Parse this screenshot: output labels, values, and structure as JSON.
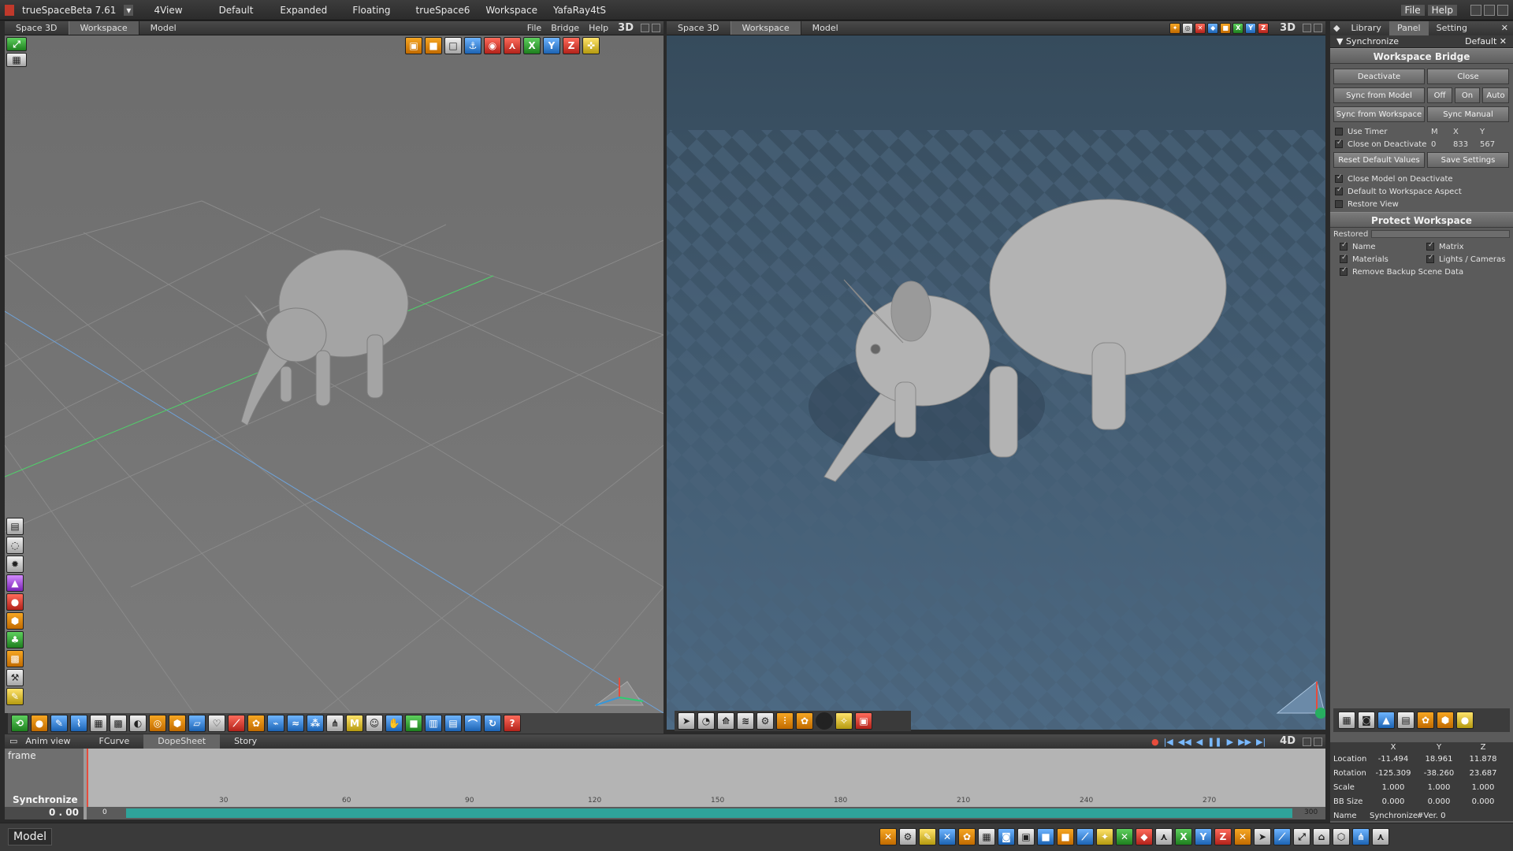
{
  "titlebar": {
    "app_title": "trueSpaceBeta 7.61",
    "menu_items": [
      "4View",
      "Default",
      "Expanded",
      "Floating",
      "trueSpace6",
      "Workspace",
      "YafaRay4tS"
    ],
    "file": "File",
    "help": "Help"
  },
  "left_pane": {
    "tabs": [
      "Space 3D",
      "Workspace",
      "Model"
    ],
    "menu": [
      "File",
      "Bridge",
      "Help"
    ],
    "mode": "3D"
  },
  "right_pane": {
    "tabs": [
      "Space 3D",
      "Workspace",
      "Model"
    ],
    "mode": "3D"
  },
  "right_panel": {
    "tabs": [
      "Library",
      "Panel",
      "Setting"
    ],
    "section": "Synchronize",
    "preset": "Default",
    "title": "Workspace Bridge",
    "buttons": {
      "deactivate": "Deactivate",
      "close": "Close",
      "sync_from_model": "Sync from Model",
      "off": "Off",
      "on": "On",
      "auto": "Auto",
      "sync_from_workspace": "Sync from Workspace",
      "sync_manual": "Sync Manual",
      "reset_default": "Reset Default Values",
      "save_settings": "Save Settings"
    },
    "use_timer": "Use Timer",
    "m": "M",
    "x": "X",
    "y": "Y",
    "close_on_deactivate": "Close on Deactivate",
    "cod_m": "0",
    "cod_x": "833",
    "cod_y": "567",
    "options": [
      "Close Model on Deactivate",
      "Default to Workspace Aspect",
      "Restore View"
    ],
    "protect_title": "Protect Workspace",
    "restored": "Restored",
    "protect": {
      "name": "Name",
      "matrix": "Matrix",
      "materials": "Materials",
      "lights": "Lights / Cameras",
      "remove_backup": "Remove Backup Scene Data"
    }
  },
  "timeline": {
    "tabs": [
      "Anim view",
      "FCurve",
      "DopeSheet",
      "Story"
    ],
    "frame_label": "frame",
    "track_label": "Synchronize",
    "time": "0 . 00",
    "ticks": [
      "30",
      "60",
      "90",
      "120",
      "150",
      "180",
      "210",
      "240",
      "270"
    ],
    "range_start": "0",
    "range_end": "300",
    "mode": "4D"
  },
  "object_info": {
    "headers": [
      "X",
      "Y",
      "Z"
    ],
    "rows": [
      {
        "label": "Location",
        "x": "-11.494",
        "y": "18.961",
        "z": "11.878"
      },
      {
        "label": "Rotation",
        "x": "-125.309",
        "y": "-38.260",
        "z": "23.687"
      },
      {
        "label": "Scale",
        "x": "1.000",
        "y": "1.000",
        "z": "1.000"
      },
      {
        "label": "BB Size",
        "x": "0.000",
        "y": "0.000",
        "z": "0.000"
      }
    ],
    "name_label": "Name",
    "name_value": "Synchronize",
    "name_extra": "#Ver. 0"
  },
  "status": {
    "mode": "Model"
  }
}
